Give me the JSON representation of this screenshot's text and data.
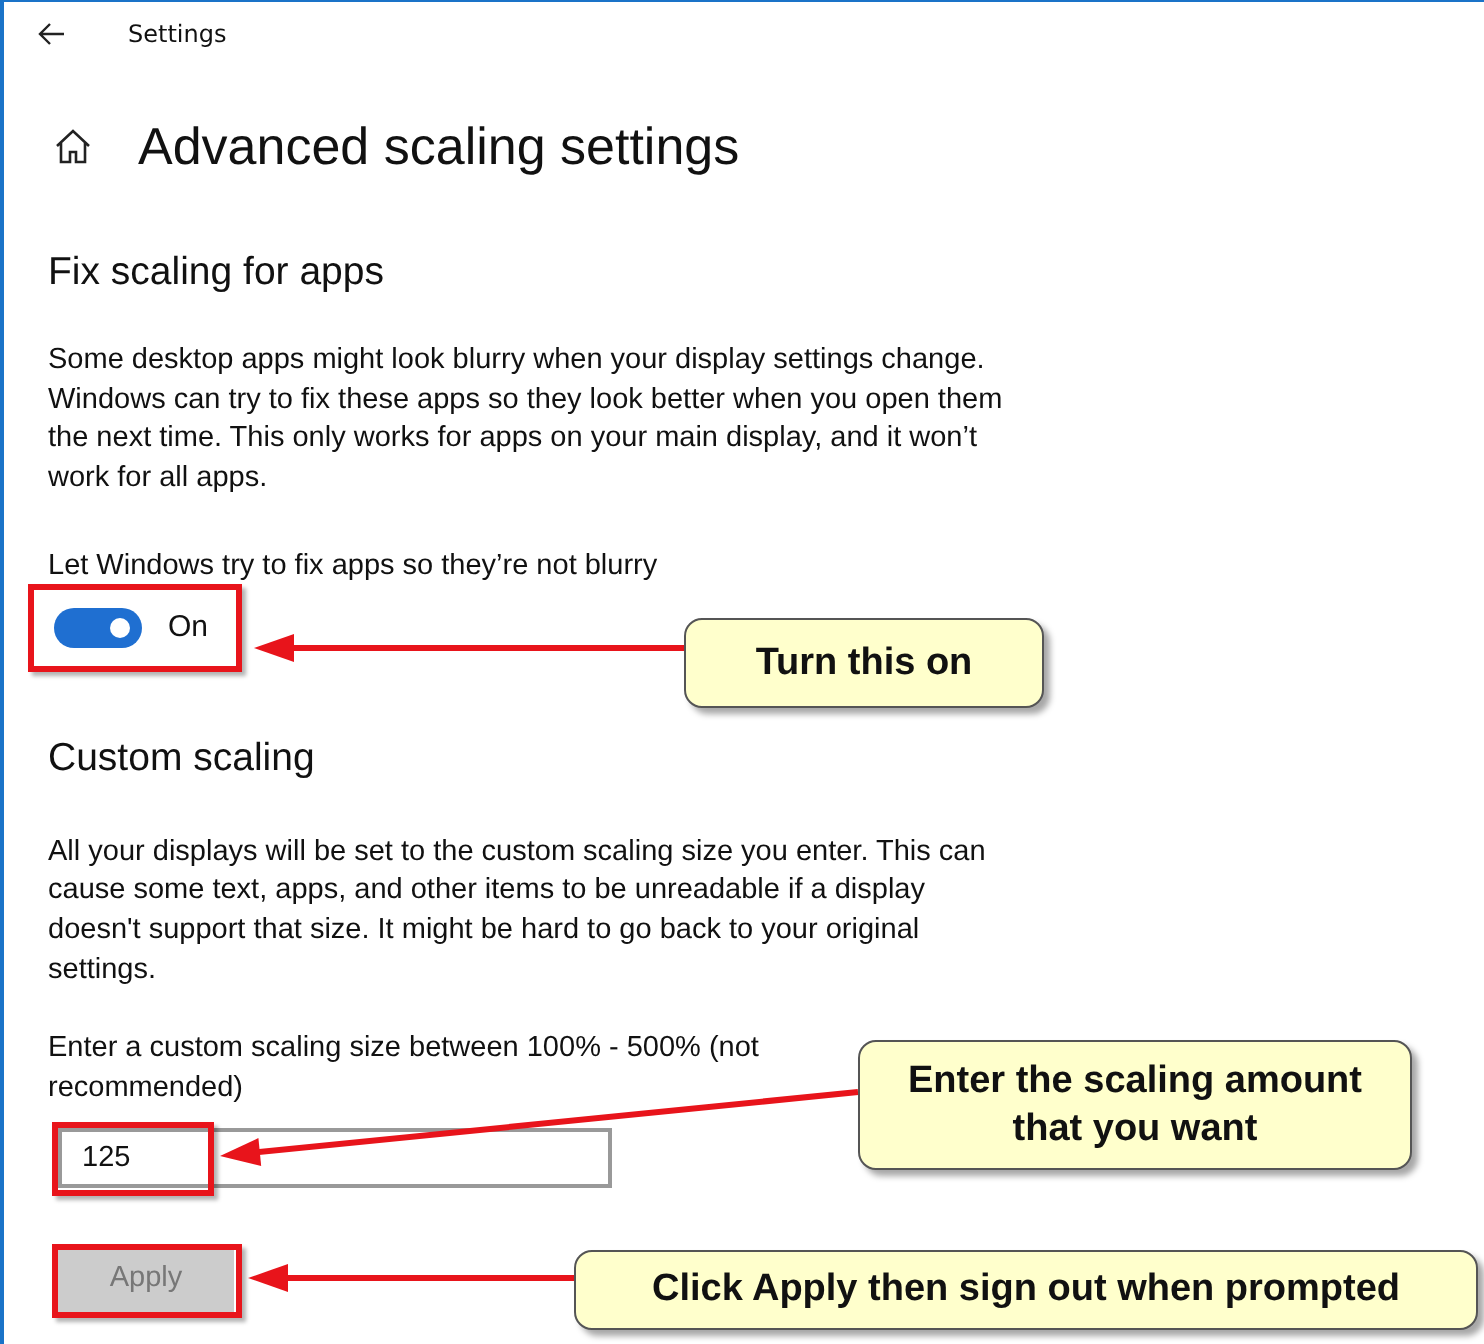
{
  "window": {
    "title": "Settings"
  },
  "page_title": "Advanced scaling settings",
  "sections": [
    {
      "heading": "Fix scaling for apps",
      "description": "Some desktop apps might look blurry when your display settings change. Windows can try to fix these apps so they look better when you open them the next time. This only works for apps on your main display, and it won’t work for all apps.",
      "kind": "toggle",
      "label": "Let Windows try to fix apps so they’re not blurry",
      "toggle": {
        "on": true,
        "state_text": "On"
      }
    },
    {
      "heading": "Custom scaling",
      "description": "All your displays will be set to the custom scaling size you enter. This can cause some text, apps, and other items to be unreadable if a display doesn't support that size. It might be hard to go back to your original settings.",
      "kind": "entry",
      "label": "Enter a custom scaling size between 100% - 500% (not recommended)",
      "field": {
        "value": "125"
      },
      "button": {
        "label": "Apply",
        "disabled": true
      }
    }
  ],
  "annotations": [
    {
      "text": "Turn this on"
    },
    {
      "text": "Enter the scaling amount that you want"
    },
    {
      "text": "Click Apply then sign out when prompted"
    }
  ]
}
